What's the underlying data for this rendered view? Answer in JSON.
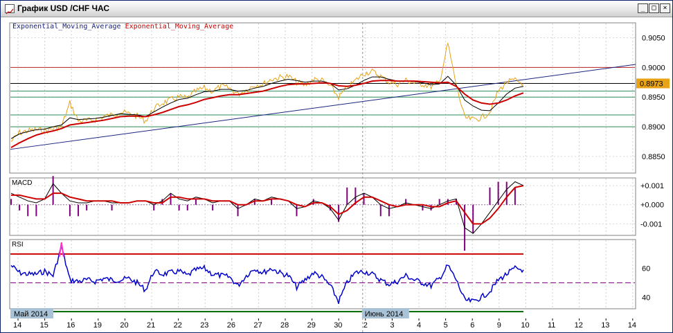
{
  "window": {
    "title": "График USD /CHF ЧАС",
    "controls": {
      "minimize": "_",
      "maximize": "□",
      "close": "×"
    }
  },
  "colors": {
    "price": "#e8a317",
    "ema_fast": "#000000",
    "ema_slow": "#cc0000",
    "trendline": "#1a237e",
    "hline_red": "#b22222",
    "hline_green": "#2e8b57",
    "rsi_line": "#0000cc",
    "rsi_high": "#cc0000",
    "rsi_low": "#006400",
    "macd_hist": "#800080",
    "price_badge": "#e8a317"
  },
  "main_chart": {
    "legend": [
      "Exponential_Moving_Average",
      "Exponential_Moving_Average"
    ],
    "price_badge": "0.8973"
  },
  "macd_panel": {
    "title": "MACD"
  },
  "rsi_panel": {
    "title": "RSI"
  },
  "month_labels": {
    "may": "Май 2014",
    "june": "Июнь 2014"
  },
  "chart_data": [
    {
      "type": "line",
      "name": "price",
      "x": [
        "14",
        "15",
        "16",
        "19",
        "20",
        "21",
        "22",
        "23",
        "26",
        "27",
        "28",
        "29",
        "30",
        "2",
        "3",
        "4",
        "5",
        "6",
        "9",
        "10",
        "11",
        "12",
        "13",
        "14"
      ],
      "y_ticks": [
        0.885,
        0.89,
        0.895,
        0.9,
        0.905
      ],
      "y_tick_labels": [
        "0.8850",
        "0.8900",
        "0.8950",
        "0.9000",
        "0.9050"
      ],
      "ylim": [
        0.8822,
        0.9075
      ],
      "price_series": [
        0.8875,
        0.889,
        0.8893,
        0.8895,
        0.8893,
        0.8897,
        0.89,
        0.894,
        0.891,
        0.891,
        0.8912,
        0.8917,
        0.892,
        0.8925,
        0.8922,
        0.8918,
        0.891,
        0.893,
        0.894,
        0.8945,
        0.895,
        0.8948,
        0.896,
        0.8965,
        0.896,
        0.8968,
        0.8965,
        0.8955,
        0.8962,
        0.897,
        0.8972,
        0.898,
        0.8983,
        0.8985,
        0.8975,
        0.897,
        0.898,
        0.8978,
        0.8968,
        0.895,
        0.8965,
        0.8978,
        0.899,
        0.8993,
        0.8985,
        0.8975,
        0.8972,
        0.8978,
        0.8974,
        0.8972,
        0.8968,
        0.8975,
        0.904,
        0.897,
        0.8915,
        0.8912,
        0.8915,
        0.8925,
        0.896,
        0.8975,
        0.8978,
        0.8973
      ],
      "ema_fast_series": [
        0.888,
        0.8888,
        0.8892,
        0.8895,
        0.8896,
        0.89,
        0.8903,
        0.8915,
        0.8912,
        0.8913,
        0.8914,
        0.8916,
        0.8919,
        0.8922,
        0.8921,
        0.892,
        0.8917,
        0.8925,
        0.8933,
        0.894,
        0.8946,
        0.8948,
        0.8954,
        0.8959,
        0.896,
        0.8963,
        0.8963,
        0.896,
        0.8961,
        0.8965,
        0.8968,
        0.8973,
        0.8977,
        0.898,
        0.8978,
        0.8975,
        0.8977,
        0.8977,
        0.8973,
        0.8962,
        0.8964,
        0.897,
        0.8978,
        0.8984,
        0.8984,
        0.898,
        0.8977,
        0.8977,
        0.8976,
        0.8974,
        0.8971,
        0.8972,
        0.8985,
        0.897,
        0.8945,
        0.8935,
        0.8928,
        0.8927,
        0.894,
        0.8955,
        0.8965,
        0.8968
      ],
      "ema_slow_series": [
        0.8865,
        0.8873,
        0.888,
        0.8886,
        0.889,
        0.8893,
        0.8897,
        0.8903,
        0.8905,
        0.8907,
        0.8909,
        0.8911,
        0.8914,
        0.8917,
        0.8918,
        0.8918,
        0.8917,
        0.892,
        0.8924,
        0.8929,
        0.8934,
        0.8937,
        0.8941,
        0.8946,
        0.8949,
        0.8952,
        0.8954,
        0.8954,
        0.8956,
        0.8958,
        0.896,
        0.8964,
        0.8968,
        0.8971,
        0.8972,
        0.8972,
        0.8973,
        0.8974,
        0.8973,
        0.8969,
        0.8968,
        0.897,
        0.8973,
        0.8977,
        0.8978,
        0.8978,
        0.8977,
        0.8977,
        0.8977,
        0.8976,
        0.8975,
        0.8974,
        0.8975,
        0.8968,
        0.8955,
        0.8945,
        0.894,
        0.8938,
        0.894,
        0.8945,
        0.8952,
        0.8957
      ],
      "h_lines": [
        {
          "y": 0.9,
          "color": "hline_red"
        },
        {
          "y": 0.8973,
          "color": "ema_fast"
        },
        {
          "y": 0.896,
          "color": "hline_green"
        },
        {
          "y": 0.895,
          "color": "hline_green"
        },
        {
          "y": 0.892,
          "color": "hline_green"
        },
        {
          "y": 0.89,
          "color": "hline_green"
        }
      ],
      "trendline": {
        "from": 0.8862,
        "to": 0.9005
      }
    },
    {
      "type": "bar",
      "name": "macd",
      "y_ticks": [
        0.001,
        0.0,
        -0.001
      ],
      "y_tick_labels": [
        "+0.001",
        "+0.000",
        "-0.001"
      ],
      "ylim": [
        -0.0016,
        0.0014
      ],
      "macd_series": [
        0.0006,
        0.0004,
        0.0002,
        0.0001,
        0.0003,
        0.0011,
        0.0006,
        0.0002,
        0.0001,
        0.0001,
        0.0002,
        0.0002,
        0.0001,
        0.0001,
        0.0001,
        0.0002,
        0.0002,
        0.0,
        0.0002,
        0.0006,
        0.0003,
        0.0002,
        0.0004,
        0.0003,
        0.0001,
        0.0002,
        0.0002,
        -0.0002,
        0.0,
        0.0003,
        0.0002,
        0.0004,
        0.0003,
        0.0002,
        -0.0002,
        -0.0001,
        0.0002,
        0.0001,
        -0.0002,
        -0.0008,
        0.0,
        0.0004,
        0.0006,
        0.0004,
        0.0,
        -0.0002,
        -0.0001,
        0.0001,
        0.0,
        -0.0001,
        -0.0002,
        0.0,
        0.0002,
        0.0003,
        -0.0012,
        -0.0015,
        -0.001,
        -0.0004,
        0.0002,
        0.0008,
        0.0012,
        0.001
      ],
      "signal_series": [
        0.0005,
        0.0005,
        0.0004,
        0.0003,
        0.0003,
        0.0006,
        0.0006,
        0.0004,
        0.0003,
        0.0002,
        0.0002,
        0.0002,
        0.0002,
        0.0001,
        0.0001,
        0.0002,
        0.0002,
        0.0001,
        0.0001,
        0.0004,
        0.0004,
        0.0003,
        0.0003,
        0.0003,
        0.0002,
        0.0002,
        0.0002,
        0.0,
        0.0,
        0.0002,
        0.0002,
        0.0003,
        0.0003,
        0.0002,
        0.0,
        -0.0001,
        0.0001,
        0.0001,
        -0.0001,
        -0.0005,
        -0.0003,
        0.0001,
        0.0004,
        0.0004,
        0.0002,
        0.0,
        -0.0001,
        0.0,
        0.0,
        0.0,
        -0.0001,
        -0.0001,
        0.0001,
        0.0002,
        -0.0004,
        -0.001,
        -0.001,
        -0.0007,
        -0.0002,
        0.0004,
        0.0009,
        0.001
      ]
    },
    {
      "type": "line",
      "name": "rsi",
      "y_ticks": [
        40,
        60
      ],
      "y_tick_labels": [
        "40",
        "60"
      ],
      "ylim": [
        32,
        80
      ],
      "levels": [
        70,
        50,
        30
      ],
      "rsi_series": [
        62,
        57,
        56,
        56,
        58,
        55,
        75,
        52,
        51,
        52,
        51,
        53,
        52,
        52,
        53,
        50,
        45,
        58,
        56,
        57,
        58,
        55,
        59,
        60,
        56,
        55,
        54,
        48,
        55,
        60,
        57,
        60,
        57,
        55,
        47,
        52,
        57,
        54,
        48,
        37,
        50,
        57,
        58,
        56,
        52,
        49,
        51,
        55,
        52,
        50,
        48,
        53,
        62,
        52,
        38,
        37,
        40,
        44,
        52,
        56,
        60,
        59
      ]
    }
  ],
  "x_axis": {
    "labels": [
      "14",
      "15",
      "16",
      "19",
      "20",
      "21",
      "22",
      "23",
      "26",
      "27",
      "28",
      "29",
      "30",
      "2",
      "3",
      "4",
      "5",
      "6",
      "9",
      "10",
      "11",
      "12",
      "13",
      "14"
    ]
  }
}
